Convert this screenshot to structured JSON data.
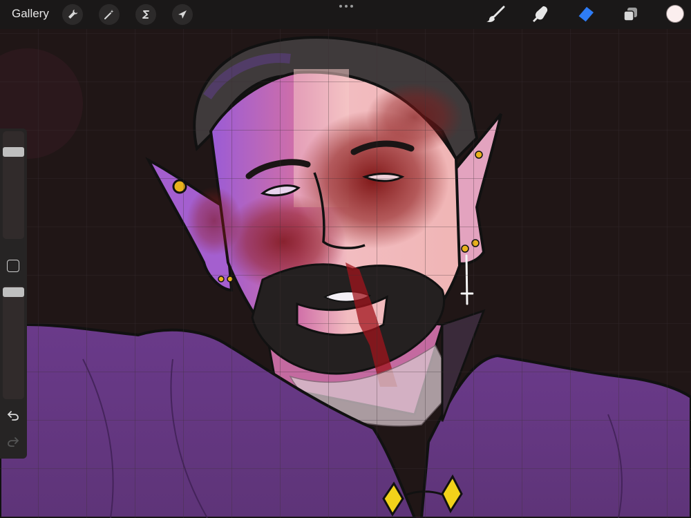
{
  "app": {
    "gallery_label": "Gallery"
  },
  "toolbar_left": [
    {
      "name": "actions-button",
      "icon": "wrench-icon"
    },
    {
      "name": "adjustments-button",
      "icon": "magic-wand-icon"
    },
    {
      "name": "selection-button",
      "icon": "selection-s-icon"
    },
    {
      "name": "transform-button",
      "icon": "arrow-cursor-icon"
    }
  ],
  "toolbar_right": [
    {
      "name": "brush-tool",
      "icon": "brush-icon",
      "active": false
    },
    {
      "name": "smudge-tool",
      "icon": "smudge-finger-icon",
      "active": false
    },
    {
      "name": "eraser-tool",
      "icon": "eraser-icon",
      "active": true
    },
    {
      "name": "layers-button",
      "icon": "layers-icon",
      "active": false
    }
  ],
  "current_color": "#fbeeee",
  "accent_color": "#2e7cf6",
  "sidebar": {
    "brush_size_level": 0.15,
    "brush_opacity_level": 0.0,
    "undo_icon": "undo-icon",
    "redo_icon": "redo-icon",
    "modify_icon": "square-icon"
  }
}
